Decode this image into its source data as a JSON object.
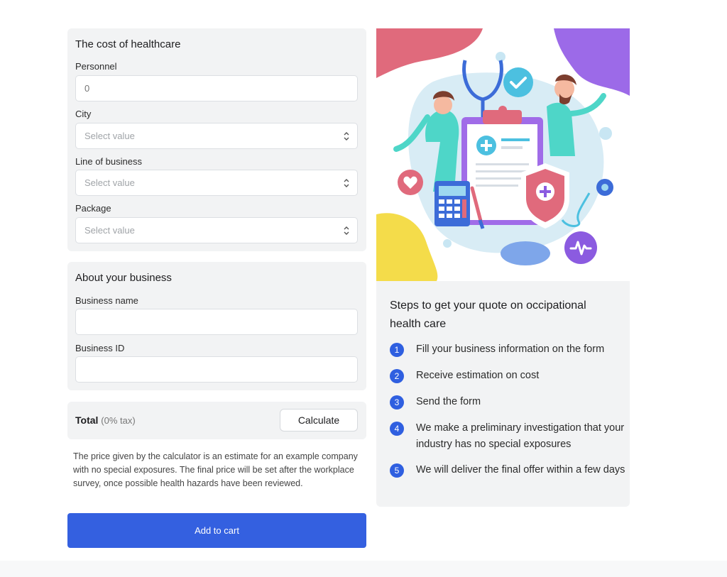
{
  "healthcare_card": {
    "title": "The cost of healthcare",
    "personnel": {
      "label": "Personnel",
      "placeholder": "0"
    },
    "city": {
      "label": "City",
      "placeholder": "Select value"
    },
    "line_of_business": {
      "label": "Line of business",
      "placeholder": "Select value"
    },
    "package": {
      "label": "Package",
      "placeholder": "Select value"
    }
  },
  "business_card": {
    "title": "About your business",
    "business_name": {
      "label": "Business name",
      "value": ""
    },
    "business_id": {
      "label": "Business ID",
      "value": ""
    }
  },
  "total": {
    "label": "Total",
    "tax": "(0% tax)",
    "calculate_label": "Calculate"
  },
  "disclaimer": "The price given by the calculator is an estimate for an example company with no special exposures. The final price will be set after the workplace survey, once possible health hazards have been reviewed.",
  "add_to_cart_label": "Add to cart",
  "steps": {
    "title": "Steps to get your quote on occipational health care",
    "items": [
      {
        "number": "1",
        "text": "Fill your business information on the form"
      },
      {
        "number": "2",
        "text": "Receive estimation on cost"
      },
      {
        "number": "3",
        "text": "Send the form"
      },
      {
        "number": "4",
        "text": "We make a preliminary investigation that your industry has no special exposures"
      },
      {
        "number": "5",
        "text": "We will deliver the final offer within a few days"
      }
    ]
  },
  "colors": {
    "primary": "#3460e0",
    "step_badge": "#2f5fe0",
    "card_bg": "#f2f3f4"
  }
}
